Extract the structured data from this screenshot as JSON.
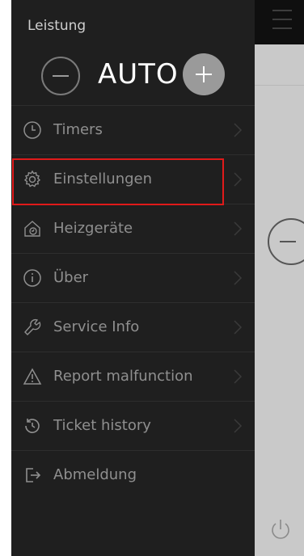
{
  "panel": {
    "title": "Leistung",
    "mode_value": "AUTO"
  },
  "menu": {
    "items": [
      {
        "label": "Timers",
        "icon": "clock-icon"
      },
      {
        "label": "Einstellungen",
        "icon": "gear-icon"
      },
      {
        "label": "Heizgeräte",
        "icon": "home-heater-icon"
      },
      {
        "label": "Über",
        "icon": "info-icon"
      },
      {
        "label": "Service Info",
        "icon": "wrench-icon"
      },
      {
        "label": "Report malfunction",
        "icon": "warning-icon"
      },
      {
        "label": "Ticket history",
        "icon": "history-icon"
      },
      {
        "label": "Abmeldung",
        "icon": "logout-icon"
      }
    ]
  },
  "colors": {
    "drawer_bg": "#1f1f1f",
    "label": "#8f8f8f",
    "highlight": "#e01a1a",
    "accent": "#3e6f96"
  }
}
